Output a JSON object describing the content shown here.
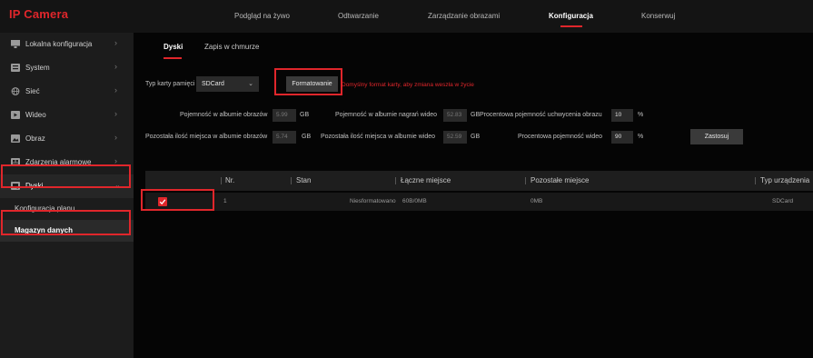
{
  "app": {
    "logo": "IP Camera"
  },
  "topnav": [
    {
      "label": "Podgląd na żywo",
      "active": false
    },
    {
      "label": "Odtwarzanie",
      "active": false
    },
    {
      "label": "Zarządzanie obrazami",
      "active": false
    },
    {
      "label": "Konfiguracja",
      "active": true
    },
    {
      "label": "Konserwuj",
      "active": false
    }
  ],
  "sidebar": {
    "items": [
      {
        "label": "Lokalna konfiguracja",
        "icon": "monitor-icon"
      },
      {
        "label": "System",
        "icon": "system-icon"
      },
      {
        "label": "Sieć",
        "icon": "globe-icon"
      },
      {
        "label": "Wideo",
        "icon": "video-icon"
      },
      {
        "label": "Obraz",
        "icon": "image-icon"
      },
      {
        "label": "Zdarzenia alarmowe",
        "icon": "alarm-icon"
      },
      {
        "label": "Dyski",
        "icon": "disk-icon",
        "expanded": true
      }
    ],
    "subitems": [
      {
        "label": "Konfiguracja planu",
        "active": false
      },
      {
        "label": "Magazyn danych",
        "active": true
      }
    ]
  },
  "tabs": [
    {
      "label": "Dyski",
      "active": true
    },
    {
      "label": "Zapis w chmurze",
      "active": false
    }
  ],
  "form": {
    "memory_type_label": "Typ karty pamięci",
    "memory_type_value": "SDCard",
    "format_button": "Formatowanie",
    "format_warning": "Domyślny format karty, aby zmiana weszła w życie",
    "image_capacity_label": "Pojemność w albumie obrazów",
    "image_capacity_value": "5.99",
    "video_capacity_label": "Pojemność w albumie nagrań wideo",
    "video_capacity_value": "52.83",
    "image_percent_label": "Procentowa pojemność uchwycenia obrazu",
    "image_percent_value": "10",
    "image_remaining_label": "Pozostała ilość miejsca w albumie obrazów",
    "image_remaining_value": "5.74",
    "video_remaining_label": "Pozostała ilość miejsca w albumie wideo",
    "video_remaining_value": "52.59",
    "video_percent_label": "Procentowa pojemność wideo",
    "video_percent_value": "90",
    "unit_gb": "GB",
    "unit_percent": "%",
    "apply_button": "Zastosuj"
  },
  "table": {
    "columns": [
      "Nr.",
      "Stan",
      "Łączne miejsce",
      "Pozostałe miejsce",
      "Typ urządzenia"
    ],
    "rows": [
      {
        "checked": true,
        "nr": "1",
        "stan": "Niesformatowano",
        "total": "60B/0MB",
        "remaining": "0MB",
        "type": "SDCard"
      }
    ]
  },
  "colors": {
    "accent": "#e0262b",
    "background": "#000000",
    "sidebar": "#1c1c1c"
  }
}
